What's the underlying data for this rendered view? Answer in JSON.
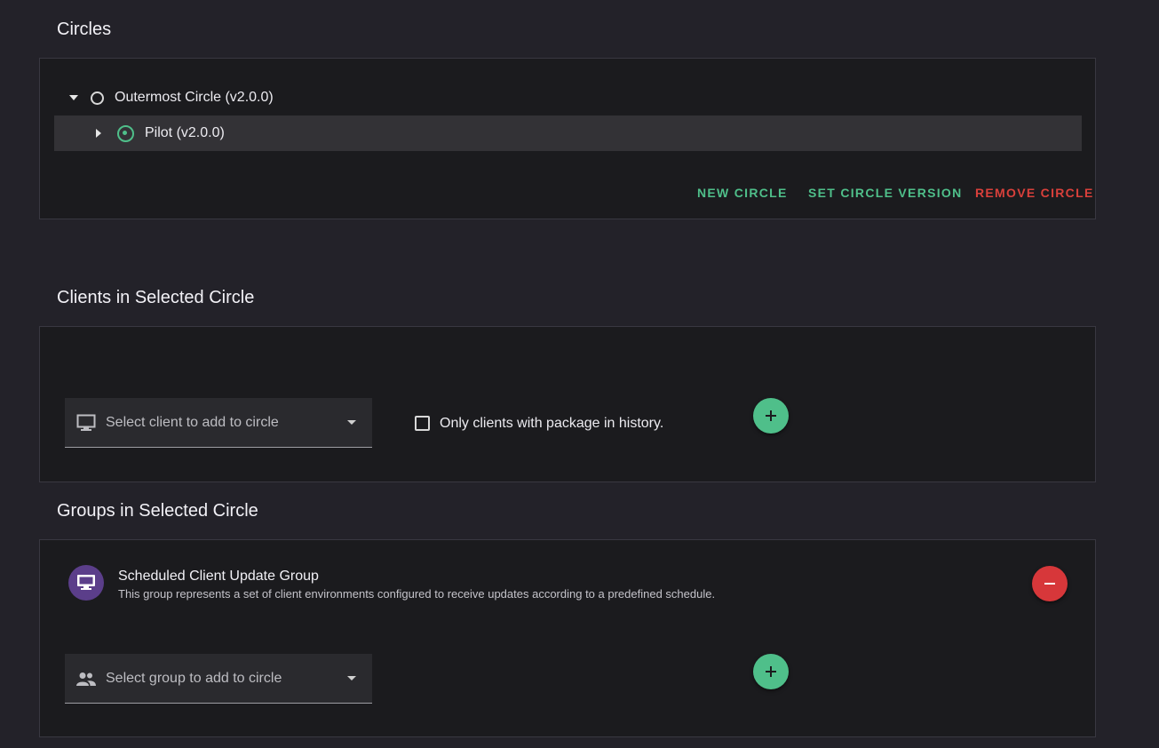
{
  "circles": {
    "title": "Circles",
    "tree": [
      {
        "label": "Outermost Circle (v2.0.0)",
        "expanded": true,
        "selected": false
      },
      {
        "label": "Pilot (v2.0.0)",
        "expanded": false,
        "selected": true
      }
    ],
    "actions": {
      "new": "NEW CIRCLE",
      "set_version": "SET CIRCLE VERSION",
      "remove": "REMOVE CIRCLE"
    }
  },
  "clients": {
    "title": "Clients in Selected Circle",
    "select_placeholder": "Select client to add to circle",
    "filter_label": "Only clients with package in history.",
    "filter_checked": false,
    "add_icon": "plus-icon"
  },
  "groups": {
    "title": "Groups in Selected Circle",
    "items": [
      {
        "name": "Scheduled Client Update Group",
        "description": "This group represents a set of client environments configured to receive updates according to a predefined schedule.",
        "icon": "monitor-icon"
      }
    ],
    "select_placeholder": "Select group to add to circle",
    "add_icon": "plus-icon"
  },
  "colors": {
    "accent": "#4fbf8a",
    "danger": "#d9403b",
    "avatar": "#5b3e8a",
    "background": "#232229",
    "panel": "#1b1b1e"
  }
}
